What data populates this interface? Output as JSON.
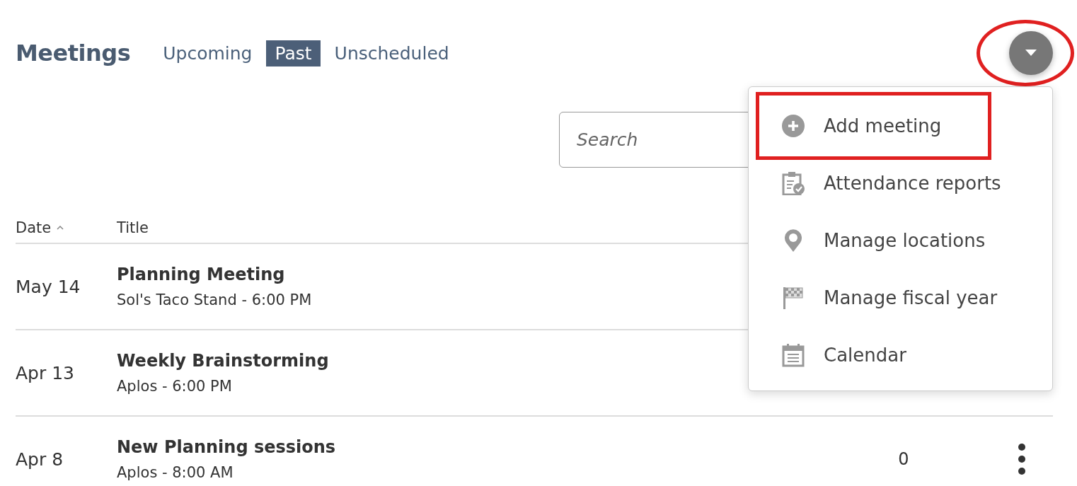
{
  "header": {
    "title": "Meetings",
    "tabs": [
      {
        "label": "Upcoming",
        "selected": false
      },
      {
        "label": "Past",
        "selected": true
      },
      {
        "label": "Unscheduled",
        "selected": false
      }
    ],
    "menu_button": {
      "highlighted": true
    }
  },
  "search": {
    "placeholder": "Search"
  },
  "table": {
    "columns": [
      {
        "label": "Date",
        "sorted": true
      },
      {
        "label": "Title",
        "sorted": false
      }
    ],
    "rows": [
      {
        "date": "May 14",
        "title": "Planning Meeting",
        "subtitle": "Sol's Taco Stand - 6:00 PM"
      },
      {
        "date": "Apr 13",
        "title": "Weekly Brainstorming",
        "subtitle": "Aplos - 6:00 PM"
      },
      {
        "date": "Apr 8",
        "title": "New Planning sessions",
        "subtitle": "Aplos - 8:00 AM",
        "count": "0",
        "actions": true
      }
    ]
  },
  "menu": {
    "items": [
      {
        "kind": "add",
        "label": "Add meeting",
        "highlighted": true
      },
      {
        "kind": "report",
        "label": "Attendance reports",
        "highlighted": false
      },
      {
        "kind": "location",
        "label": "Manage locations",
        "highlighted": false
      },
      {
        "kind": "fiscal",
        "label": "Manage fiscal year",
        "highlighted": false
      },
      {
        "kind": "calendar",
        "label": "Calendar",
        "highlighted": false
      }
    ]
  }
}
